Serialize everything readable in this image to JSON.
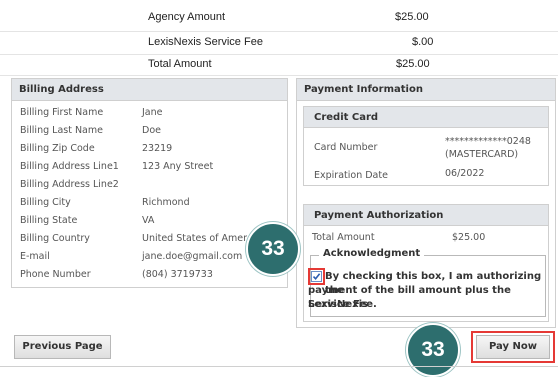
{
  "summary": {
    "rows": [
      {
        "label": "Agency Amount",
        "value": "$25.00"
      },
      {
        "label": "LexisNexis Service Fee",
        "value": "$.00"
      },
      {
        "label": "Total Amount",
        "value": "$25.00"
      }
    ]
  },
  "billing": {
    "title": "Billing Address",
    "fields": [
      {
        "label": "Billing First Name",
        "value": "Jane"
      },
      {
        "label": "Billing Last Name",
        "value": "Doe"
      },
      {
        "label": "Billing Zip Code",
        "value": "23219"
      },
      {
        "label": "Billing Address Line1",
        "value": "123 Any Street"
      },
      {
        "label": "Billing Address Line2",
        "value": ""
      },
      {
        "label": "Billing City",
        "value": "Richmond"
      },
      {
        "label": "Billing State",
        "value": "VA"
      },
      {
        "label": "Billing Country",
        "value": "United States of Amer"
      },
      {
        "label": "E-mail",
        "value": "jane.doe@gmail.com"
      },
      {
        "label": "Phone Number",
        "value": "(804) 3719733"
      }
    ]
  },
  "payment": {
    "title": "Payment Information",
    "credit_card": {
      "title": "Credit Card",
      "card_number_label": "Card Number",
      "card_number_value": "*************0248",
      "card_type": "(MASTERCARD)",
      "expiration_label": "Expiration Date",
      "expiration_value": "06/2022"
    },
    "authorization": {
      "title": "Payment Authorization",
      "total_label": "Total Amount",
      "total_value": "$25.00",
      "ack_legend": "Acknowledgment",
      "consent_lines": [
        "By checking this box, I am authorizing the",
        "payment of the bill amount plus the LexisNexis",
        "Service Fee."
      ],
      "checked": true
    }
  },
  "buttons": {
    "previous": "Previous Page",
    "pay_now": "Pay Now"
  },
  "badges": {
    "step_checkbox": "33",
    "step_pay": "33"
  },
  "colors": {
    "highlight": "#e53935",
    "badge": "#2d6e6e",
    "panel_header": "#e3e6ea"
  }
}
